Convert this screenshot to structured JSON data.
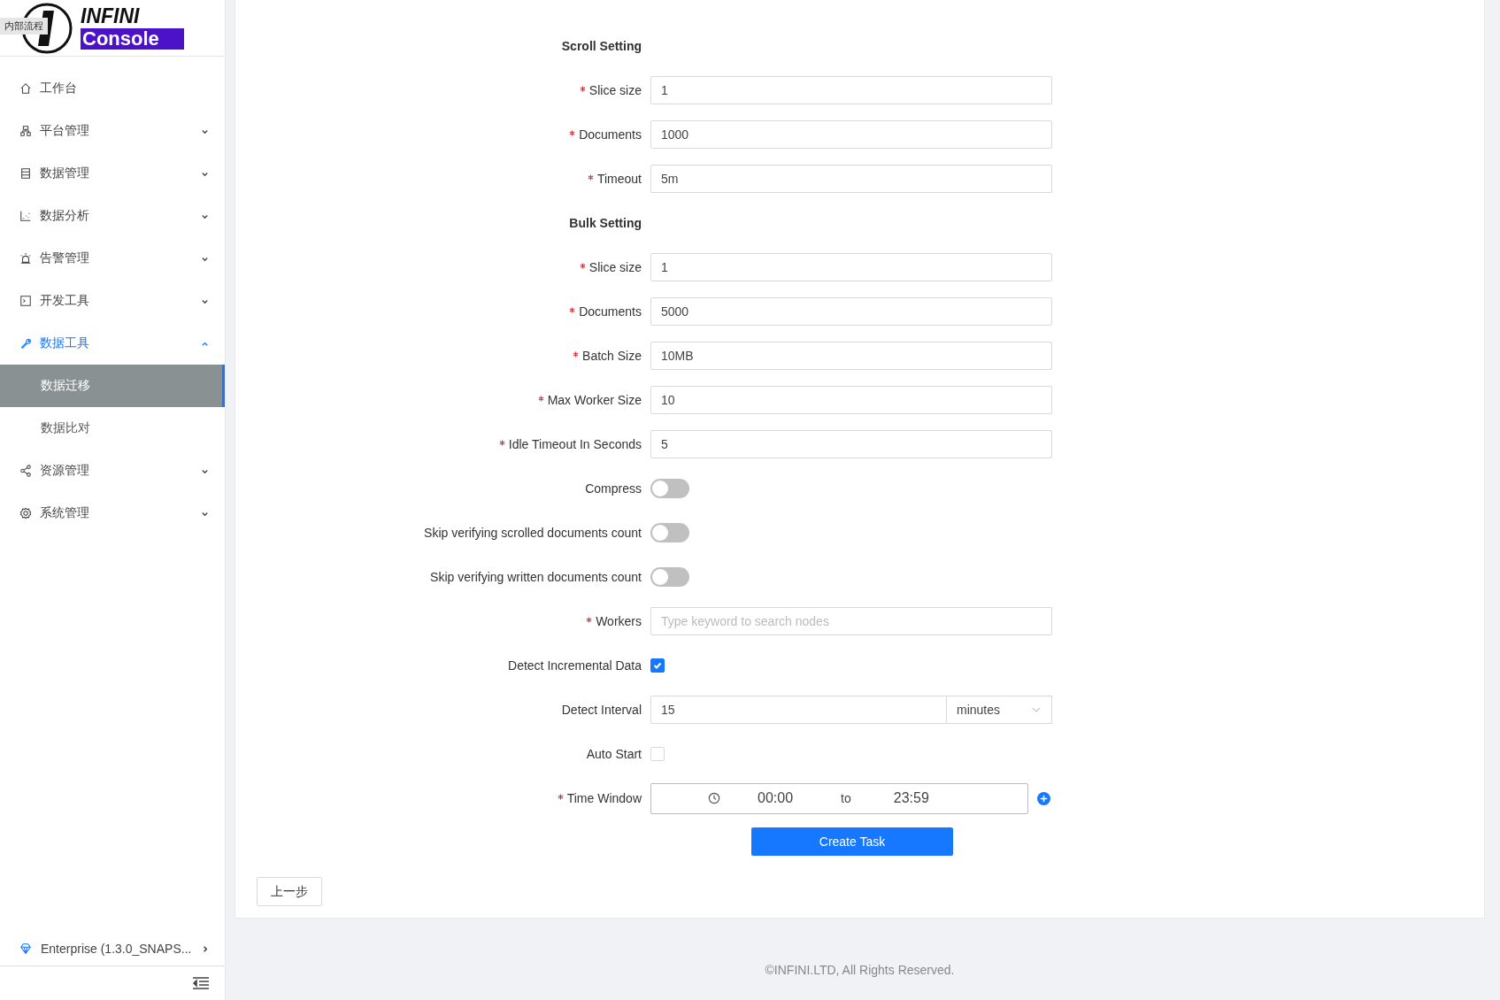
{
  "logo": {
    "title": "INFINI",
    "subtitle": "Console",
    "tag": "内部流程"
  },
  "sidebar": {
    "items": [
      {
        "label": "工作台",
        "expandable": false,
        "expanded": false,
        "selected": false
      },
      {
        "label": "平台管理",
        "expandable": true,
        "expanded": false,
        "selected": false
      },
      {
        "label": "数据管理",
        "expandable": true,
        "expanded": false,
        "selected": false
      },
      {
        "label": "数据分析",
        "expandable": true,
        "expanded": false,
        "selected": false
      },
      {
        "label": "告警管理",
        "expandable": true,
        "expanded": false,
        "selected": false
      },
      {
        "label": "开发工具",
        "expandable": true,
        "expanded": false,
        "selected": false
      },
      {
        "label": "数据工具",
        "expandable": true,
        "expanded": true,
        "selected": true,
        "children": [
          {
            "label": "数据迁移",
            "selected": true
          },
          {
            "label": "数据比对",
            "selected": false
          }
        ]
      },
      {
        "label": "资源管理",
        "expandable": true,
        "expanded": false,
        "selected": false
      },
      {
        "label": "系统管理",
        "expandable": true,
        "expanded": false,
        "selected": false
      }
    ],
    "edition": "Enterprise (1.3.0_SNAPS..."
  },
  "form": {
    "items": [
      {
        "kind": "heading",
        "label": "Scroll Setting"
      },
      {
        "kind": "input",
        "label": "Slice size",
        "required": true,
        "value": "1"
      },
      {
        "kind": "input",
        "label": "Documents",
        "required": true,
        "value": "1000"
      },
      {
        "kind": "input",
        "label": "Timeout",
        "required": true,
        "value": "5m"
      },
      {
        "kind": "heading",
        "label": "Bulk Setting"
      },
      {
        "kind": "input",
        "label": "Slice size",
        "required": true,
        "value": "1"
      },
      {
        "kind": "input",
        "label": "Documents",
        "required": true,
        "value": "5000"
      },
      {
        "kind": "input",
        "label": "Batch Size",
        "required": true,
        "value": "10MB"
      },
      {
        "kind": "input",
        "label": "Max Worker Size",
        "required": true,
        "value": "10"
      },
      {
        "kind": "input",
        "label": "Idle Timeout In Seconds",
        "required": true,
        "value": "5"
      },
      {
        "kind": "switch",
        "label": "Compress",
        "required": false,
        "on": false
      },
      {
        "kind": "switch",
        "label": "Skip verifying scrolled documents count",
        "required": false,
        "on": false
      },
      {
        "kind": "switch",
        "label": "Skip verifying written documents count",
        "required": false,
        "on": false
      },
      {
        "kind": "input",
        "label": "Workers",
        "required": true,
        "placeholder": "Type keyword to search nodes"
      },
      {
        "kind": "checkbox",
        "label": "Detect Incremental Data",
        "required": false,
        "checked": true
      },
      {
        "kind": "interval",
        "label": "Detect Interval",
        "required": false,
        "value": "15",
        "unit": "minutes"
      },
      {
        "kind": "checkbox",
        "label": "Auto Start",
        "required": false,
        "checked": false
      },
      {
        "kind": "timewindow",
        "label": "Time Window",
        "required": true,
        "start": "00:00",
        "separator": "to",
        "end": "23:59"
      }
    ],
    "submit": "Create Task",
    "back": "上一步"
  },
  "footer": "©INFINI.LTD, All Rights Reserved."
}
